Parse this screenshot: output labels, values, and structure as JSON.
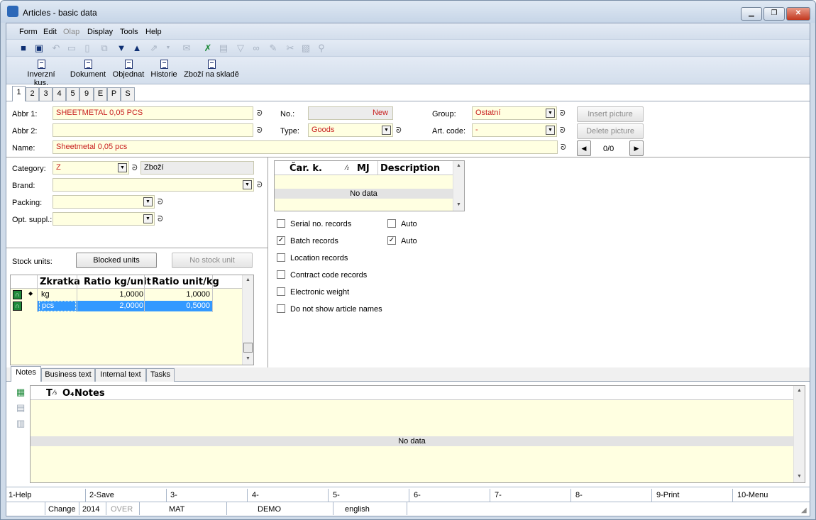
{
  "window": {
    "title": "Articles - basic data"
  },
  "menu": [
    "Form",
    "Edit",
    "Olap",
    "Display",
    "Tools",
    "Help"
  ],
  "menu_disabled": [
    "Olap"
  ],
  "big_buttons": [
    "Inverzní kus.",
    "Dokument",
    "Objednat",
    "Historie",
    "Zboží na skladě"
  ],
  "tabs": [
    "1",
    "2",
    "3",
    "4",
    "5",
    "9",
    "E",
    "P",
    "S"
  ],
  "header": {
    "abbr1_label": "Abbr 1:",
    "abbr1_value": "SHEETMETAL 0,05 PCS",
    "abbr2_label": "Abbr 2:",
    "abbr2_value": "",
    "name_label": "Name:",
    "name_value": "Sheetmetal 0,05 pcs",
    "no_label": "No.:",
    "no_value": "New",
    "type_label": "Type:",
    "type_value": "Goods",
    "group_label": "Group:",
    "group_value": "Ostatní",
    "artcode_label": "Art. code:",
    "artcode_value": "-",
    "insert_picture": "Insert picture",
    "delete_picture": "Delete picture",
    "picture_counter": "0/0"
  },
  "left": {
    "category_label": "Category:",
    "category_value": "Z",
    "category_desc": "Zboží",
    "brand_label": "Brand:",
    "brand_value": "",
    "packing_label": "Packing:",
    "packing_value": "",
    "optsuppl_label": "Opt. suppl.:",
    "optsuppl_value": "",
    "stock_units_label": "Stock units:",
    "blocked_units": "Blocked units",
    "no_stock_unit": "No stock unit"
  },
  "units_grid": {
    "headers": [
      "Zkratka",
      "Ratio kg/unit",
      "Ratio unit/kg"
    ],
    "rows": [
      {
        "unit": "kg",
        "marker": "◆",
        "ratio_kg_unit": "1,0000",
        "ratio_unit_kg": "1,0000"
      },
      {
        "unit": "pcs",
        "marker": "",
        "ratio_kg_unit": "2,0000",
        "ratio_unit_kg": "0,5000"
      }
    ]
  },
  "barcode_grid": {
    "headers": [
      "Čar. k.",
      "⁄₂",
      "MJ",
      "Description"
    ],
    "no_data": "No data"
  },
  "checkboxes": [
    {
      "label": "Serial no. records",
      "checked": false
    },
    {
      "label": "Batch records",
      "checked": true
    },
    {
      "label": "Location records",
      "checked": false
    },
    {
      "label": "Contract code records",
      "checked": false
    },
    {
      "label": "Electronic weight",
      "checked": false
    },
    {
      "label": "Do not show article names",
      "checked": false
    }
  ],
  "auto_checkboxes": [
    {
      "label": "Auto",
      "checked": false
    },
    {
      "label": "Auto",
      "checked": true
    }
  ],
  "bottom_tabs": [
    "Notes",
    "Business text",
    "Internal text",
    "Tasks"
  ],
  "notes_grid": {
    "headers": [
      "T",
      "⁄₃",
      "O₄",
      "Notes"
    ],
    "no_data": "No data"
  },
  "fkeys": [
    "1-Help",
    "2-Save",
    "3-",
    "4-",
    "5-",
    "6-",
    "7-",
    "8-",
    "9-Print",
    "10-Menu"
  ],
  "status": {
    "mode": "Change",
    "year": "2014",
    "over": "OVER",
    "user": "MAT",
    "db": "DEMO",
    "lang": "english"
  },
  "colors": {
    "accent": "#3399ff",
    "field_bg": "#ffffe1",
    "red_text": "#c81e1e",
    "chrome": "#cfdbe9"
  }
}
